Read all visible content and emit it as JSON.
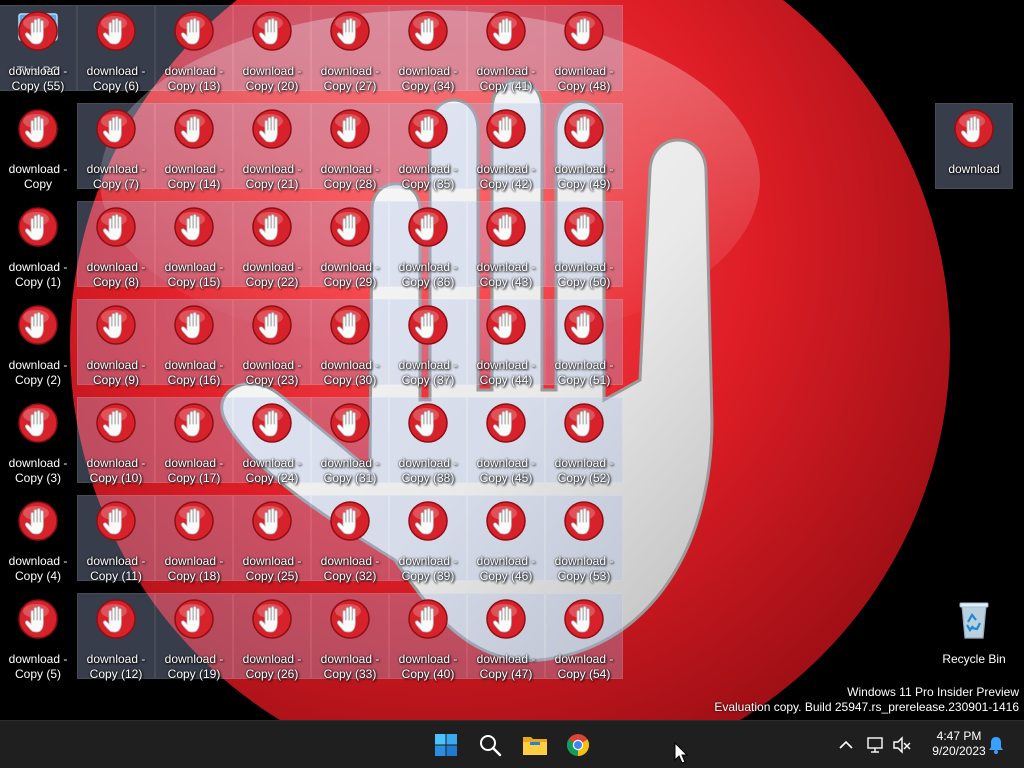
{
  "desktop": {
    "special_icons": [
      {
        "id": "this-pc",
        "label": "This PC",
        "icon": "monitor-icon"
      },
      {
        "id": "download",
        "label": "download",
        "icon": "stop-hand-icon"
      },
      {
        "id": "recycle-bin",
        "label": "Recycle Bin",
        "icon": "recycle-bin-icon"
      }
    ],
    "first_file_label": "download - Copy",
    "copy_prefix": "download -",
    "copy_suffix_template": "Copy (n)",
    "copy_count": 55,
    "file_icon": "stop-hand-icon"
  },
  "watermark": {
    "line1": "Windows 11 Pro Insider Preview",
    "line2": "Evaluation copy. Build 25947.rs_prerelease.230901-1416"
  },
  "taskbar": {
    "pinned": [
      {
        "name": "start-button",
        "icon": "windows-logo-icon"
      },
      {
        "name": "search-button",
        "icon": "search-icon"
      },
      {
        "name": "file-explorer-button",
        "icon": "folder-icon"
      },
      {
        "name": "chrome-button",
        "icon": "chrome-icon"
      }
    ],
    "tray": {
      "chevron_icon": "chevron-up-icon",
      "network_icon": "network-icon",
      "volume_icon": "volume-muted-icon",
      "notification_icon": "bell-icon"
    },
    "clock": {
      "time": "4:47 PM",
      "date": "9/20/2023"
    }
  },
  "colors": {
    "wallpaper_red": "#d31f27",
    "taskbar": "#1f1f1f",
    "accent": "#0a84ff"
  }
}
